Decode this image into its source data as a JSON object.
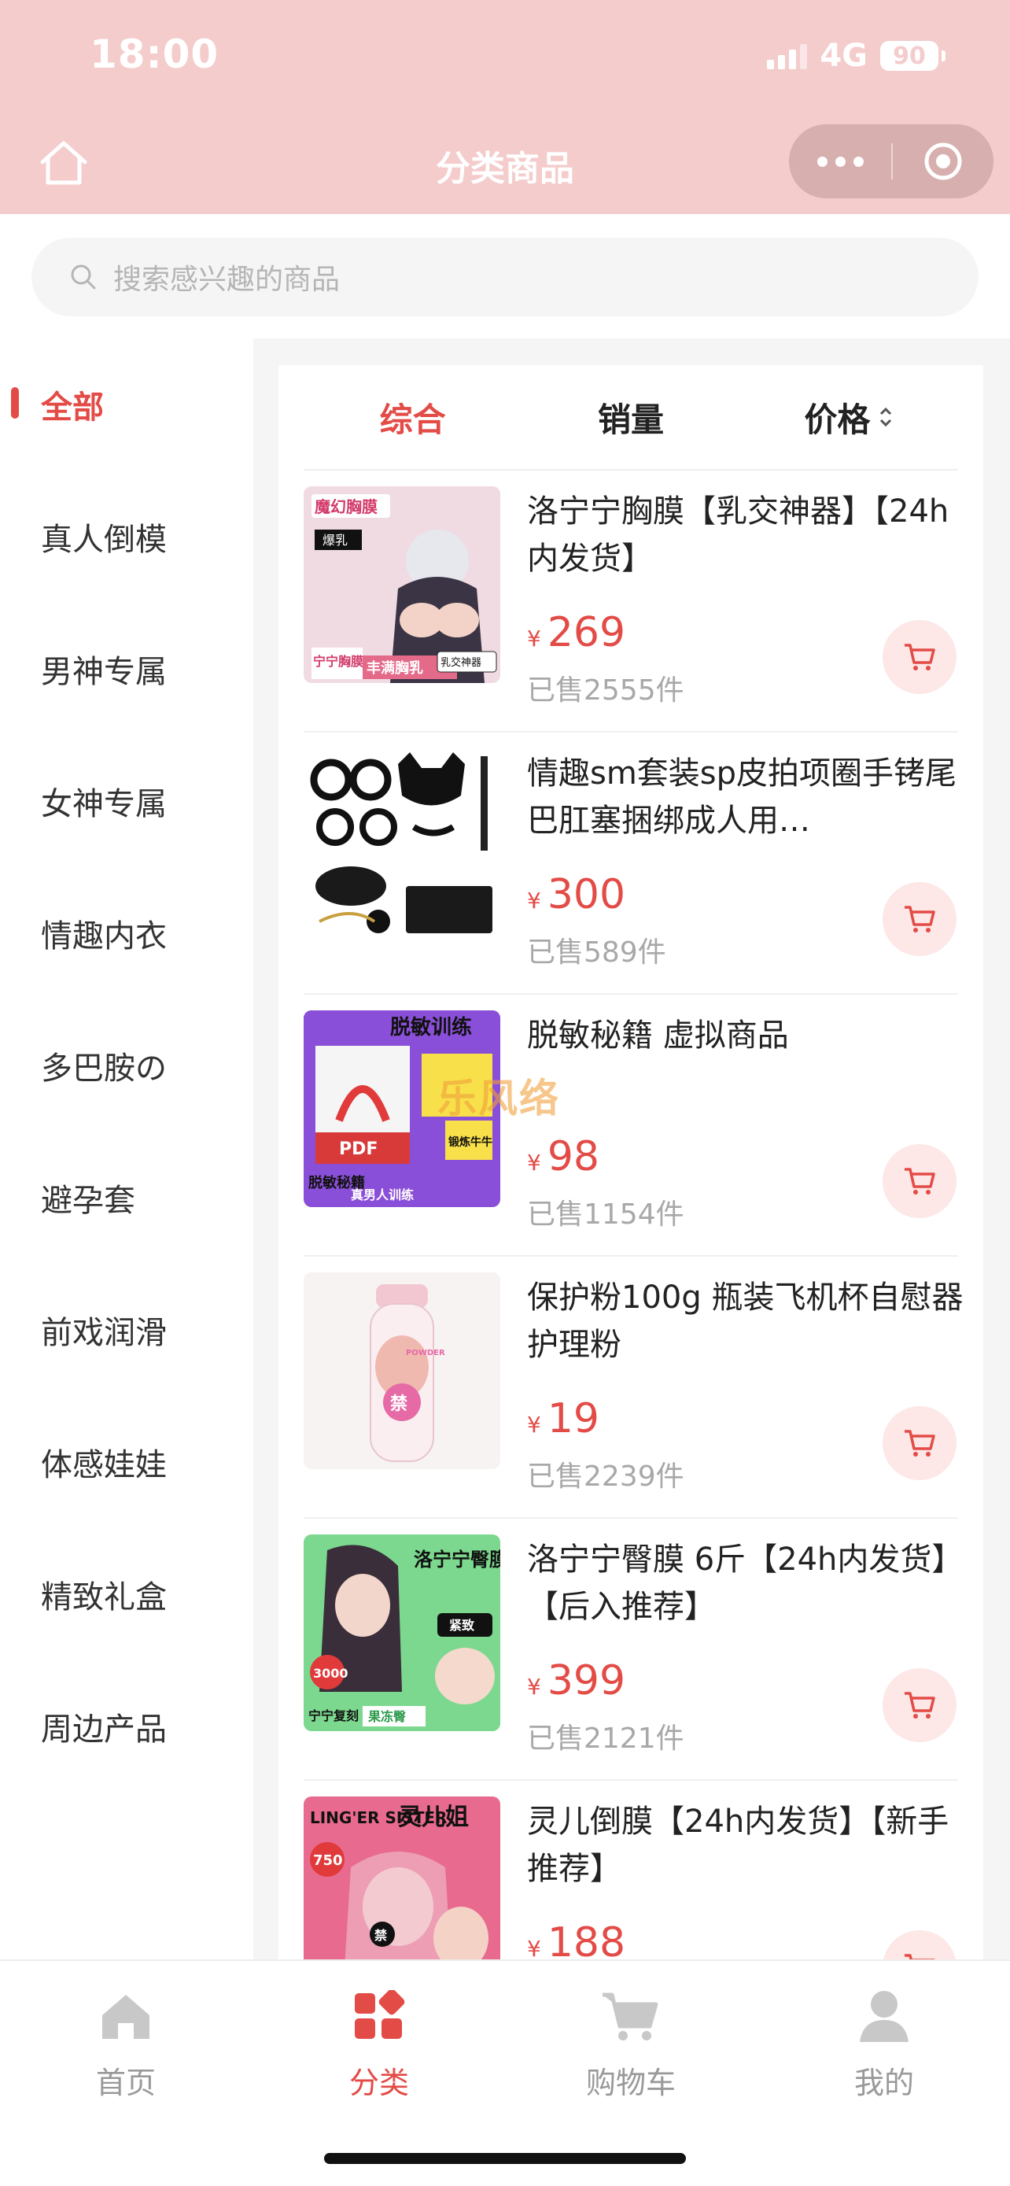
{
  "status": {
    "time": "18:00",
    "network": "4G",
    "battery": "90"
  },
  "nav": {
    "title": "分类商品"
  },
  "search": {
    "placeholder": "搜索感兴趣的商品"
  },
  "sidebar": {
    "items": [
      {
        "label": "全部",
        "active": true
      },
      {
        "label": "真人倒模"
      },
      {
        "label": "男神专属"
      },
      {
        "label": "女神专属"
      },
      {
        "label": "情趣内衣"
      },
      {
        "label": "多巴胺の"
      },
      {
        "label": "避孕套"
      },
      {
        "label": "前戏润滑"
      },
      {
        "label": "体感娃娃"
      },
      {
        "label": "精致礼盒"
      },
      {
        "label": "周边产品"
      }
    ]
  },
  "sort": {
    "overall": "综合",
    "sales": "销量",
    "price": "价格"
  },
  "products": [
    {
      "name": "洛宁宁胸膜【乳交神器】【24h内发货】",
      "currency": "¥",
      "price": "269",
      "sold": "已售2555件"
    },
    {
      "name": "情趣sm套装sp皮拍项圈手铐尾巴肛塞捆绑成人用…",
      "currency": "¥",
      "price": "300",
      "sold": "已售589件"
    },
    {
      "name": "脱敏秘籍 虚拟商品",
      "currency": "¥",
      "price": "98",
      "sold": "已售1154件"
    },
    {
      "name": "保护粉100g 瓶装飞机杯自慰器护理粉",
      "currency": "¥",
      "price": "19",
      "sold": "已售2239件"
    },
    {
      "name": "洛宁宁臀膜 6斤【24h内发货】【后入推荐】",
      "currency": "¥",
      "price": "399",
      "sold": "已售2121件"
    },
    {
      "name": "灵儿倒膜【24h内发货】【新手推荐】",
      "currency": "¥",
      "price": "188",
      "sold": ""
    }
  ],
  "thumbs": [
    {
      "title": "魔幻胸膜",
      "tag1": "爆乳",
      "tag2": "乳交神器",
      "bottom": "宁宁胸膜",
      "bottom2": "丰满胸乳"
    },
    {
      "title": "",
      "tag1": "",
      "tag2": "",
      "bottom": "",
      "bottom2": ""
    },
    {
      "title": "脱敏训练",
      "tag1": "PDF",
      "tag2": "锻炼牛牛",
      "bottom": "脱敏秘籍",
      "bottom2": "真男人训练"
    },
    {
      "title": "",
      "tag1": "禁",
      "tag2": "POWDER",
      "bottom": "",
      "bottom2": ""
    },
    {
      "title": "洛宁宁臀膜",
      "tag1": "3000",
      "tag2": "紧致",
      "bottom": "宁宁复刻",
      "bottom2": "果冻臀"
    },
    {
      "title": "灵儿姐",
      "tag1": "750",
      "tag2": "禁",
      "bottom": "LING'ER SISTER",
      "bottom2": ""
    }
  ],
  "watermark": "乐风络",
  "tabs": [
    {
      "label": "首页",
      "icon": "home-icon"
    },
    {
      "label": "分类",
      "icon": "category-icon",
      "active": true
    },
    {
      "label": "购物车",
      "icon": "cart-icon"
    },
    {
      "label": "我的",
      "icon": "user-icon"
    }
  ],
  "colors": {
    "accent": "#e34b46",
    "header": "#f4cccc",
    "cartBg": "#fde7e7"
  }
}
